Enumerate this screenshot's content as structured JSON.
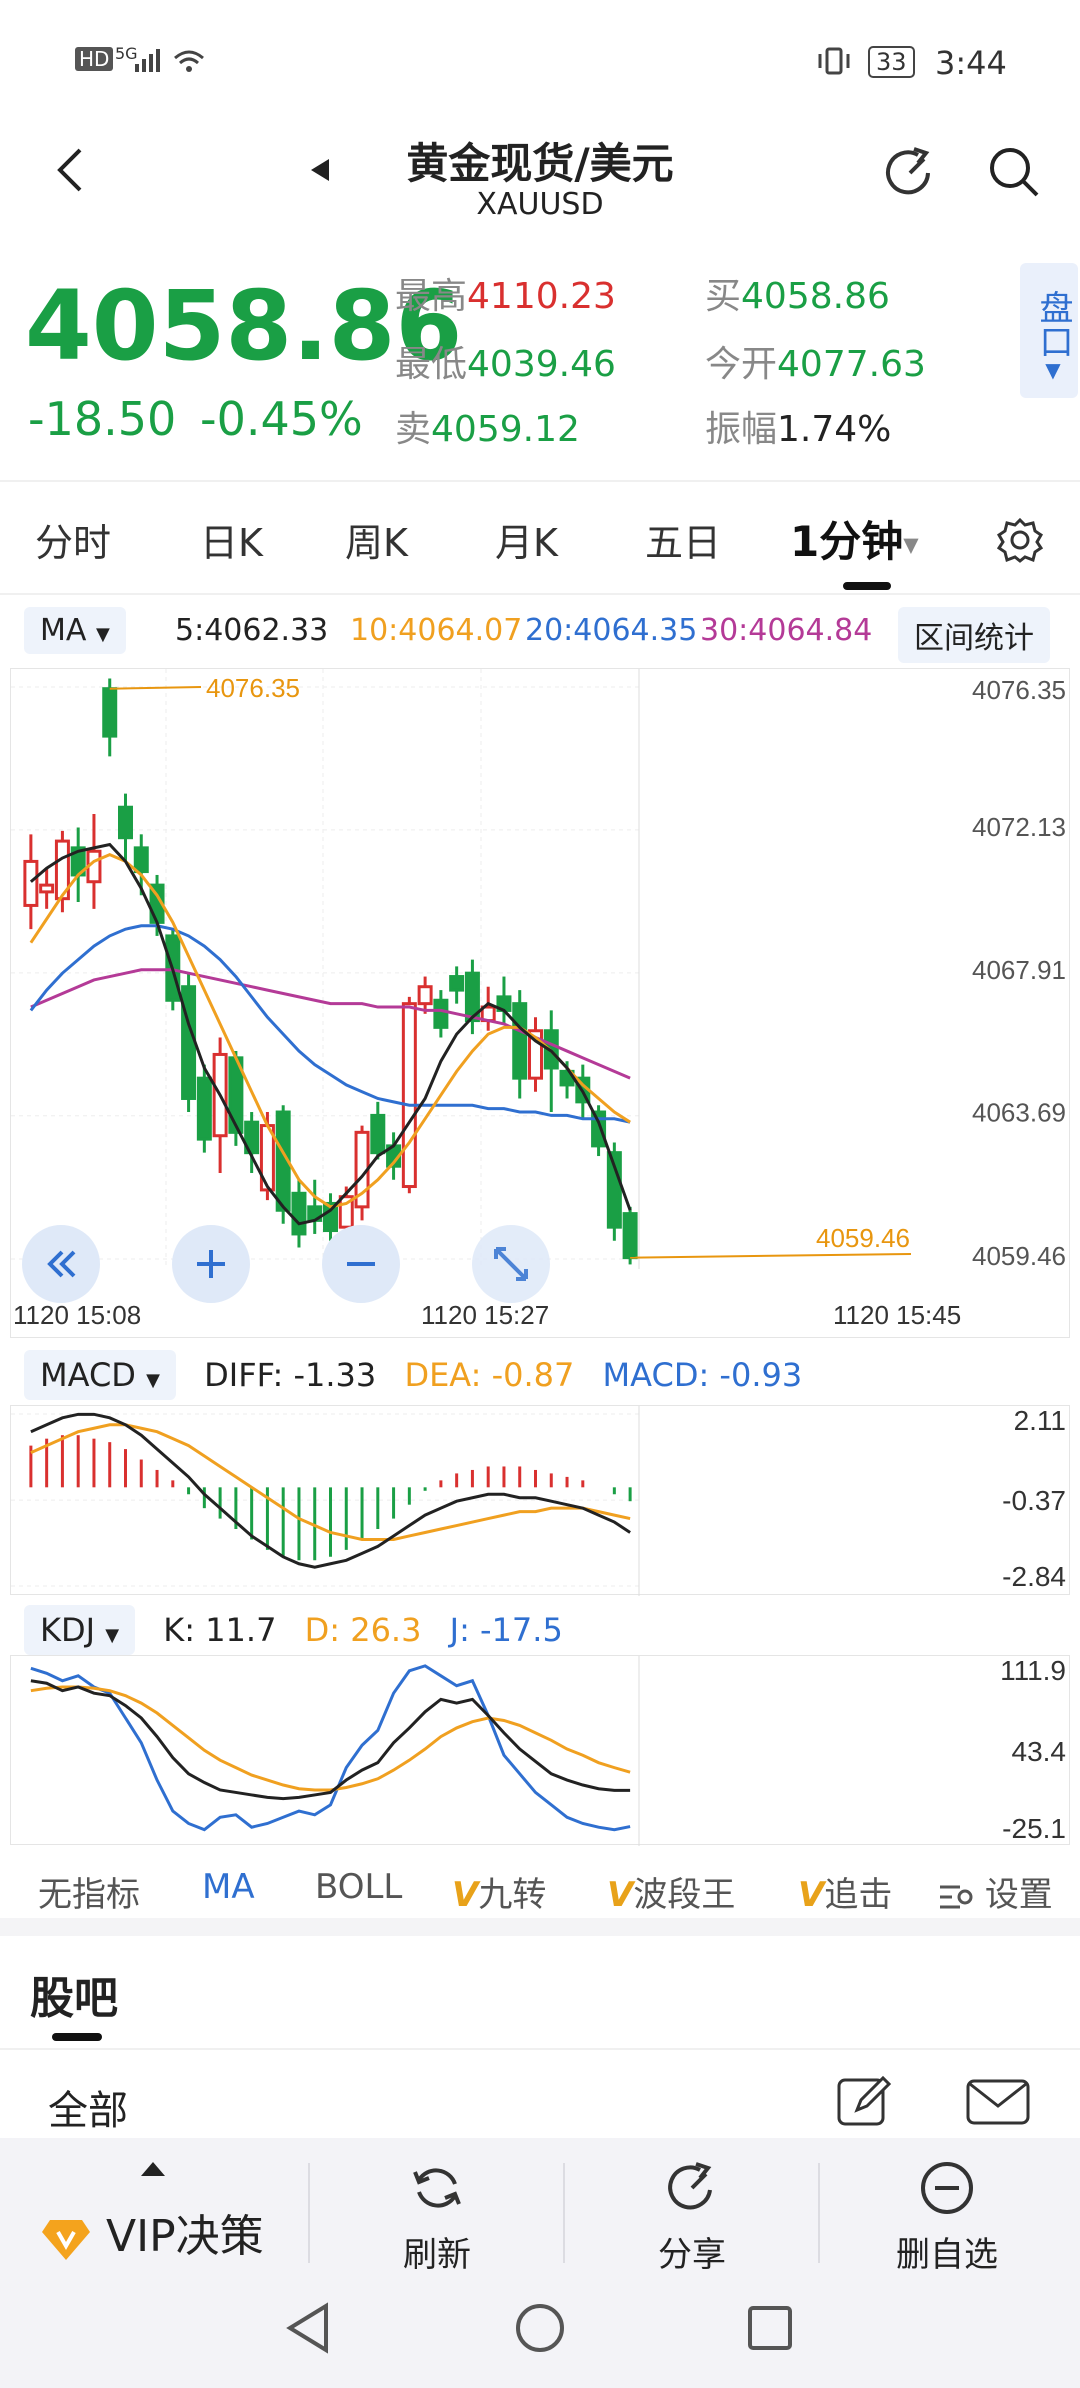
{
  "status": {
    "network": "HD",
    "signal": "5G",
    "battery": "33",
    "time": "3:44"
  },
  "nav": {
    "title": "黄金现货/美元",
    "subtitle": "XAUUSD"
  },
  "quote": {
    "price": "4058.86",
    "change": "-18.50",
    "change_pct": "-0.45%",
    "high_label": "最高",
    "high": "4110.23",
    "low_label": "最低",
    "low": "4039.46",
    "sell_label": "卖",
    "sell": "4059.12",
    "buy_label": "买",
    "buy": "4058.86",
    "open_label": "今开",
    "open": "4077.63",
    "amp_label": "振幅",
    "amp": "1.74%",
    "panel_tab": "盘口"
  },
  "tabs": [
    {
      "label": "分时"
    },
    {
      "label": "日K"
    },
    {
      "label": "周K"
    },
    {
      "label": "月K"
    },
    {
      "label": "五日"
    },
    {
      "label": "1分钟"
    }
  ],
  "ma": {
    "selector": "MA",
    "ma5": "5:4062.33",
    "ma10": "10:4064.07",
    "ma20": "20:4064.35",
    "ma30": "30:4064.84",
    "stat_button": "区间统计"
  },
  "colors": {
    "up": "#d9302f",
    "down": "#1a9f45",
    "ma5": "#222222",
    "ma10": "#f0a020",
    "ma20": "#2f6fd0",
    "ma30": "#b43a97",
    "accent": "#2f6fd0"
  },
  "main_chart": {
    "y_ticks": [
      "4076.35",
      "4072.13",
      "4067.91",
      "4063.69",
      "4059.46"
    ],
    "x_ticks": [
      "1120  15:08",
      "1120  15:27",
      "1120  15:45"
    ],
    "max_label": "4076.35",
    "min_label": "4059.46"
  },
  "chart_data": {
    "type": "candlestick",
    "ylim": [
      4059.46,
      4076.35
    ],
    "candles": [
      {
        "o": 4069.9,
        "c": 4071.2,
        "h": 4072.0,
        "l": 4069.2,
        "up": true
      },
      {
        "o": 4070.3,
        "c": 4070.5,
        "h": 4071.0,
        "l": 4069.8,
        "up": true
      },
      {
        "o": 4070.1,
        "c": 4071.8,
        "h": 4072.1,
        "l": 4069.7,
        "up": true
      },
      {
        "o": 4071.6,
        "c": 4070.8,
        "h": 4072.2,
        "l": 4070.0,
        "up": false
      },
      {
        "o": 4070.6,
        "c": 4071.5,
        "h": 4072.6,
        "l": 4069.8,
        "up": true
      },
      {
        "o": 4076.3,
        "c": 4074.9,
        "h": 4076.6,
        "l": 4074.3,
        "up": false
      },
      {
        "o": 4072.8,
        "c": 4071.9,
        "h": 4073.2,
        "l": 4071.2,
        "up": false
      },
      {
        "o": 4071.6,
        "c": 4070.9,
        "h": 4072.0,
        "l": 4070.2,
        "up": false
      },
      {
        "o": 4070.5,
        "c": 4069.4,
        "h": 4070.8,
        "l": 4069.0,
        "up": false
      },
      {
        "o": 4069.0,
        "c": 4067.1,
        "h": 4069.2,
        "l": 4066.8,
        "up": false
      },
      {
        "o": 4067.5,
        "c": 4064.2,
        "h": 4067.9,
        "l": 4063.8,
        "up": false
      },
      {
        "o": 4064.8,
        "c": 4063.0,
        "h": 4065.2,
        "l": 4062.6,
        "up": false
      },
      {
        "o": 4063.1,
        "c": 4065.5,
        "h": 4066.0,
        "l": 4062.0,
        "up": true
      },
      {
        "o": 4065.4,
        "c": 4063.2,
        "h": 4065.6,
        "l": 4062.8,
        "up": false
      },
      {
        "o": 4063.5,
        "c": 4062.6,
        "h": 4063.8,
        "l": 4062.0,
        "up": false
      },
      {
        "o": 4061.5,
        "c": 4063.4,
        "h": 4063.8,
        "l": 4061.2,
        "up": true
      },
      {
        "o": 4063.8,
        "c": 4060.9,
        "h": 4064.0,
        "l": 4060.5,
        "up": false
      },
      {
        "o": 4061.4,
        "c": 4060.2,
        "h": 4061.8,
        "l": 4059.8,
        "up": false
      },
      {
        "o": 4061.0,
        "c": 4060.6,
        "h": 4061.8,
        "l": 4060.2,
        "up": false
      },
      {
        "o": 4061.1,
        "c": 4060.3,
        "h": 4061.4,
        "l": 4060.0,
        "up": false
      },
      {
        "o": 4060.4,
        "c": 4061.3,
        "h": 4061.6,
        "l": 4060.1,
        "up": true
      },
      {
        "o": 4061.0,
        "c": 4063.2,
        "h": 4063.4,
        "l": 4060.6,
        "up": true
      },
      {
        "o": 4063.7,
        "c": 4062.6,
        "h": 4064.1,
        "l": 4062.4,
        "up": false
      },
      {
        "o": 4062.8,
        "c": 4062.2,
        "h": 4063.2,
        "l": 4061.8,
        "up": false
      },
      {
        "o": 4061.6,
        "c": 4067.0,
        "h": 4067.2,
        "l": 4061.4,
        "up": true
      },
      {
        "o": 4067.0,
        "c": 4067.5,
        "h": 4067.8,
        "l": 4066.7,
        "up": true
      },
      {
        "o": 4067.1,
        "c": 4066.3,
        "h": 4067.4,
        "l": 4066.0,
        "up": false
      },
      {
        "o": 4067.8,
        "c": 4067.4,
        "h": 4068.1,
        "l": 4067.0,
        "up": false
      },
      {
        "o": 4067.9,
        "c": 4066.5,
        "h": 4068.3,
        "l": 4066.1,
        "up": false
      },
      {
        "o": 4066.5,
        "c": 4066.9,
        "h": 4067.5,
        "l": 4066.2,
        "up": true
      },
      {
        "o": 4067.2,
        "c": 4066.8,
        "h": 4067.8,
        "l": 4066.4,
        "up": false
      },
      {
        "o": 4067.0,
        "c": 4064.8,
        "h": 4067.4,
        "l": 4064.2,
        "up": false
      },
      {
        "o": 4064.8,
        "c": 4066.2,
        "h": 4066.6,
        "l": 4064.4,
        "up": true
      },
      {
        "o": 4066.2,
        "c": 4065.1,
        "h": 4066.8,
        "l": 4063.8,
        "up": false
      },
      {
        "o": 4065.0,
        "c": 4064.6,
        "h": 4065.3,
        "l": 4064.2,
        "up": false
      },
      {
        "o": 4064.8,
        "c": 4064.1,
        "h": 4065.2,
        "l": 4063.6,
        "up": false
      },
      {
        "o": 4063.8,
        "c": 4062.8,
        "h": 4064.0,
        "l": 4062.5,
        "up": false
      },
      {
        "o": 4062.6,
        "c": 4060.4,
        "h": 4062.9,
        "l": 4060.0,
        "up": false
      },
      {
        "o": 4060.8,
        "c": 4059.5,
        "h": 4061.0,
        "l": 4059.3,
        "up": false
      }
    ],
    "ma5": [
      4070.6,
      4071.0,
      4071.3,
      4071.5,
      4071.6,
      4071.7,
      4071.2,
      4070.4,
      4069.4,
      4068.0,
      4066.4,
      4065.1,
      4064.3,
      4063.4,
      4062.5,
      4061.6,
      4061.0,
      4060.5,
      4060.6,
      4060.9,
      4061.4,
      4061.9,
      4062.5,
      4062.8,
      4063.5,
      4064.2,
      4065.3,
      4066.1,
      4066.6,
      4067.0,
      4066.8,
      4066.3,
      4065.9,
      4065.6,
      4065.1,
      4064.4,
      4063.5,
      4062.2,
      4060.9
    ],
    "ma10": [
      4068.8,
      4069.5,
      4070.2,
      4070.8,
      4071.2,
      4071.4,
      4071.2,
      4070.8,
      4070.2,
      4069.4,
      4068.4,
      4067.4,
      4066.4,
      4065.4,
      4064.4,
      4063.4,
      4062.6,
      4061.8,
      4061.3,
      4061.0,
      4061.1,
      4061.4,
      4061.8,
      4062.3,
      4062.9,
      4063.6,
      4064.3,
      4065.0,
      4065.6,
      4066.1,
      4066.3,
      4066.3,
      4066.0,
      4065.6,
      4065.1,
      4064.6,
      4064.2,
      4063.8,
      4063.5
    ],
    "ma20": [
      4066.8,
      4067.4,
      4067.9,
      4068.3,
      4068.7,
      4069.0,
      4069.2,
      4069.3,
      4069.3,
      4069.2,
      4069.0,
      4068.7,
      4068.3,
      4067.8,
      4067.2,
      4066.6,
      4066.1,
      4065.6,
      4065.2,
      4064.9,
      4064.6,
      4064.4,
      4064.2,
      4064.1,
      4064.0,
      4064.0,
      4064.0,
      4064.0,
      4064.0,
      4063.9,
      4063.9,
      4063.8,
      4063.8,
      4063.7,
      4063.7,
      4063.6,
      4063.6,
      4063.6,
      4063.5
    ],
    "ma30": [
      4066.9,
      4067.1,
      4067.3,
      4067.5,
      4067.7,
      4067.8,
      4067.9,
      4068.0,
      4068.0,
      4068.0,
      4067.9,
      4067.8,
      4067.7,
      4067.6,
      4067.5,
      4067.4,
      4067.3,
      4067.2,
      4067.1,
      4067.0,
      4067.0,
      4067.0,
      4066.9,
      4066.9,
      4066.9,
      4066.8,
      4066.8,
      4066.7,
      4066.6,
      4066.5,
      4066.4,
      4066.2,
      4066.0,
      4065.8,
      4065.6,
      4065.4,
      4065.2,
      4065.0,
      4064.8
    ]
  },
  "macd": {
    "selector": "MACD",
    "diff": "DIFF: -1.33",
    "dea": "DEA: -0.87",
    "macd": "MACD: -0.93",
    "y_ticks": [
      "2.11",
      "-0.37",
      "-2.84"
    ],
    "ylim": [
      -2.84,
      2.11
    ],
    "hist": [
      1.2,
      1.4,
      1.5,
      1.5,
      1.4,
      1.3,
      1.1,
      0.8,
      0.5,
      0.2,
      -0.2,
      -0.6,
      -0.9,
      -1.2,
      -1.5,
      -1.8,
      -2.0,
      -2.1,
      -2.1,
      -2.0,
      -1.8,
      -1.5,
      -1.2,
      -0.9,
      -0.5,
      -0.1,
      0.2,
      0.4,
      0.5,
      0.6,
      0.6,
      0.6,
      0.5,
      0.4,
      0.3,
      0.2,
      0.0,
      -0.2,
      -0.4
    ],
    "diff_line": [
      1.6,
      1.8,
      2.0,
      2.1,
      2.1,
      2.0,
      1.8,
      1.5,
      1.1,
      0.7,
      0.3,
      -0.2,
      -0.6,
      -1.0,
      -1.4,
      -1.7,
      -2.0,
      -2.2,
      -2.3,
      -2.2,
      -2.1,
      -1.9,
      -1.7,
      -1.4,
      -1.1,
      -0.8,
      -0.6,
      -0.4,
      -0.3,
      -0.2,
      -0.2,
      -0.3,
      -0.3,
      -0.4,
      -0.5,
      -0.6,
      -0.8,
      -1.0,
      -1.3
    ],
    "dea_line": [
      1.0,
      1.2,
      1.4,
      1.6,
      1.7,
      1.8,
      1.8,
      1.7,
      1.6,
      1.4,
      1.2,
      0.9,
      0.6,
      0.3,
      0.0,
      -0.3,
      -0.6,
      -0.9,
      -1.1,
      -1.3,
      -1.4,
      -1.5,
      -1.5,
      -1.5,
      -1.4,
      -1.3,
      -1.2,
      -1.1,
      -1.0,
      -0.9,
      -0.8,
      -0.7,
      -0.7,
      -0.6,
      -0.6,
      -0.6,
      -0.7,
      -0.8,
      -0.9
    ]
  },
  "kdj": {
    "selector": "KDJ",
    "k": "K: 11.7",
    "d": "D: 26.3",
    "j": "J: -17.5",
    "y_ticks": [
      "111.9",
      "43.4",
      "-25.1"
    ],
    "ylim": [
      -25.1,
      111.9
    ],
    "k_line": [
      100,
      98,
      92,
      95,
      90,
      88,
      80,
      70,
      55,
      38,
      25,
      18,
      12,
      10,
      8,
      6,
      5,
      6,
      8,
      10,
      20,
      28,
      34,
      50,
      62,
      75,
      85,
      82,
      85,
      72,
      58,
      45,
      35,
      25,
      20,
      16,
      13,
      11.7,
      11.7
    ],
    "d_line": [
      92,
      94,
      95,
      95,
      94,
      92,
      88,
      82,
      74,
      64,
      54,
      44,
      36,
      30,
      24,
      20,
      16,
      13,
      12,
      12,
      14,
      17,
      21,
      28,
      36,
      45,
      55,
      62,
      67,
      70,
      68,
      64,
      58,
      52,
      45,
      40,
      34,
      30,
      26.3
    ],
    "j_line": [
      110,
      106,
      100,
      104,
      95,
      90,
      70,
      50,
      20,
      -5,
      -15,
      -20,
      -10,
      -8,
      -18,
      -15,
      -10,
      -5,
      -8,
      0,
      30,
      48,
      60,
      90,
      108,
      112,
      104,
      96,
      100,
      72,
      40,
      25,
      10,
      0,
      -10,
      -15,
      -18,
      -20,
      -17.5
    ]
  },
  "indicator_bar": [
    {
      "label": "无指标",
      "active": false
    },
    {
      "label": "MA",
      "active": true
    },
    {
      "label": "BOLL",
      "active": false
    },
    {
      "label": "九转",
      "vip": true
    },
    {
      "label": "波段王",
      "vip": true
    },
    {
      "label": "追击",
      "vip": true
    },
    {
      "label": "设置",
      "active": false
    }
  ],
  "guba": {
    "title": "股吧",
    "filter": "全部"
  },
  "bottom_bar": {
    "vip": "VIP决策",
    "refresh": "刷新",
    "share": "分享",
    "remove": "删自选"
  }
}
